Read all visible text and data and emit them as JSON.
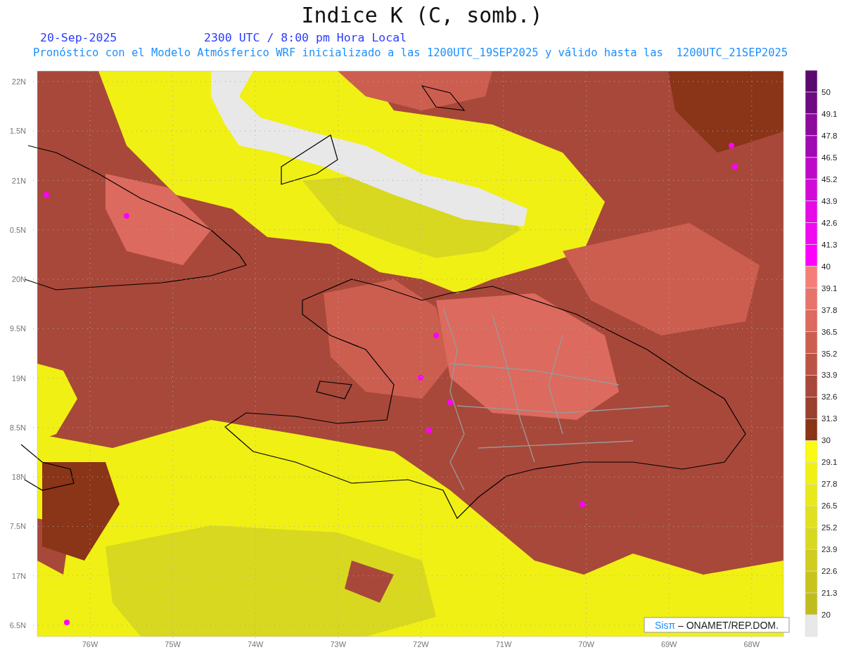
{
  "title": "Indice K (C, somb.)",
  "date": "20-Sep-2025",
  "time": "2300 UTC / 8:00 pm Hora Local",
  "subtitle": "Pronóstico con el Modelo Atmósferico WRF inicializado a las 1200UTC_19SEP2025 y válido hasta las  1200UTC_21SEP2025",
  "y_axis": [
    "22N",
    "1.5N",
    "21N",
    "0.5N",
    "20N",
    "9.5N",
    "19N",
    "8.5N",
    "18N",
    "7.5N",
    "17N",
    "6.5N"
  ],
  "x_axis": [
    "76W",
    "75W",
    "74W",
    "73W",
    "72W",
    "71W",
    "70W",
    "69W",
    "68W"
  ],
  "legend": [
    {
      "label": "50",
      "color": "#5a0a6e"
    },
    {
      "label": "49.1",
      "color": "#6e0a82"
    },
    {
      "label": "47.8",
      "color": "#8c0a9c"
    },
    {
      "label": "46.5",
      "color": "#a00ab4"
    },
    {
      "label": "45.2",
      "color": "#be0ac8"
    },
    {
      "label": "43.9",
      "color": "#d20ad8"
    },
    {
      "label": "42.6",
      "color": "#e60ae6"
    },
    {
      "label": "41.3",
      "color": "#f00af0"
    },
    {
      "label": "40",
      "color": "#ff00ff"
    },
    {
      "label": "39.1",
      "color": "#f57f78"
    },
    {
      "label": "37.8",
      "color": "#e8736a"
    },
    {
      "label": "36.5",
      "color": "#dc6a5e"
    },
    {
      "label": "35.2",
      "color": "#cc5e50"
    },
    {
      "label": "33.9",
      "color": "#bb5444"
    },
    {
      "label": "32.6",
      "color": "#a8483a"
    },
    {
      "label": "31.3",
      "color": "#9a402e"
    },
    {
      "label": "30",
      "color": "#8a3418"
    },
    {
      "label": "29.1",
      "color": "#fafa14"
    },
    {
      "label": "27.8",
      "color": "#f0f014"
    },
    {
      "label": "26.5",
      "color": "#e8e81a"
    },
    {
      "label": "25.2",
      "color": "#e0e01e"
    },
    {
      "label": "23.9",
      "color": "#d8d820"
    },
    {
      "label": "22.6",
      "color": "#d0cc20"
    },
    {
      "label": "21.3",
      "color": "#c8c41e"
    },
    {
      "label": "20",
      "color": "#c0bc1e"
    },
    {
      "color": "#e8e8e8"
    }
  ],
  "credit": {
    "logo": "Sisπ",
    "text": "– ONAMET/REP.DOM."
  }
}
